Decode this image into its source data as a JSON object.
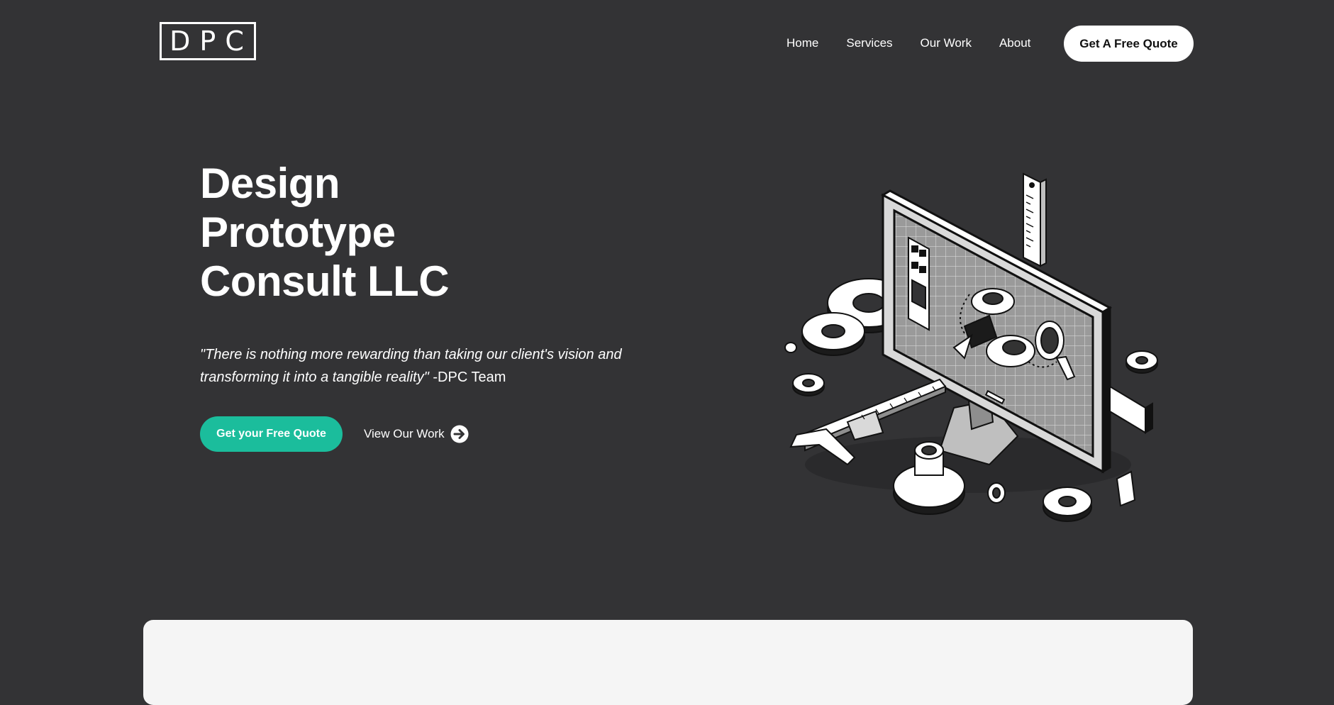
{
  "header": {
    "logo_text": "DPC",
    "nav": [
      "Home",
      "Services",
      "Our Work",
      "About"
    ],
    "cta_label": "Get A Free Quote"
  },
  "hero": {
    "title_lines": [
      "Design",
      "Prototype",
      "Consult LLC"
    ],
    "quote_text": "\"There is nothing more rewarding than taking our client's vision and transforming it into a tangible reality\"",
    "quote_author": " -DPC Team",
    "primary_cta": "Get your Free Quote",
    "secondary_cta": "View Our Work",
    "illustration_icon": "computer-engineering-illustration"
  },
  "colors": {
    "background": "#333335",
    "accent": "#1bbd9c",
    "card": "#f5f5f5"
  }
}
